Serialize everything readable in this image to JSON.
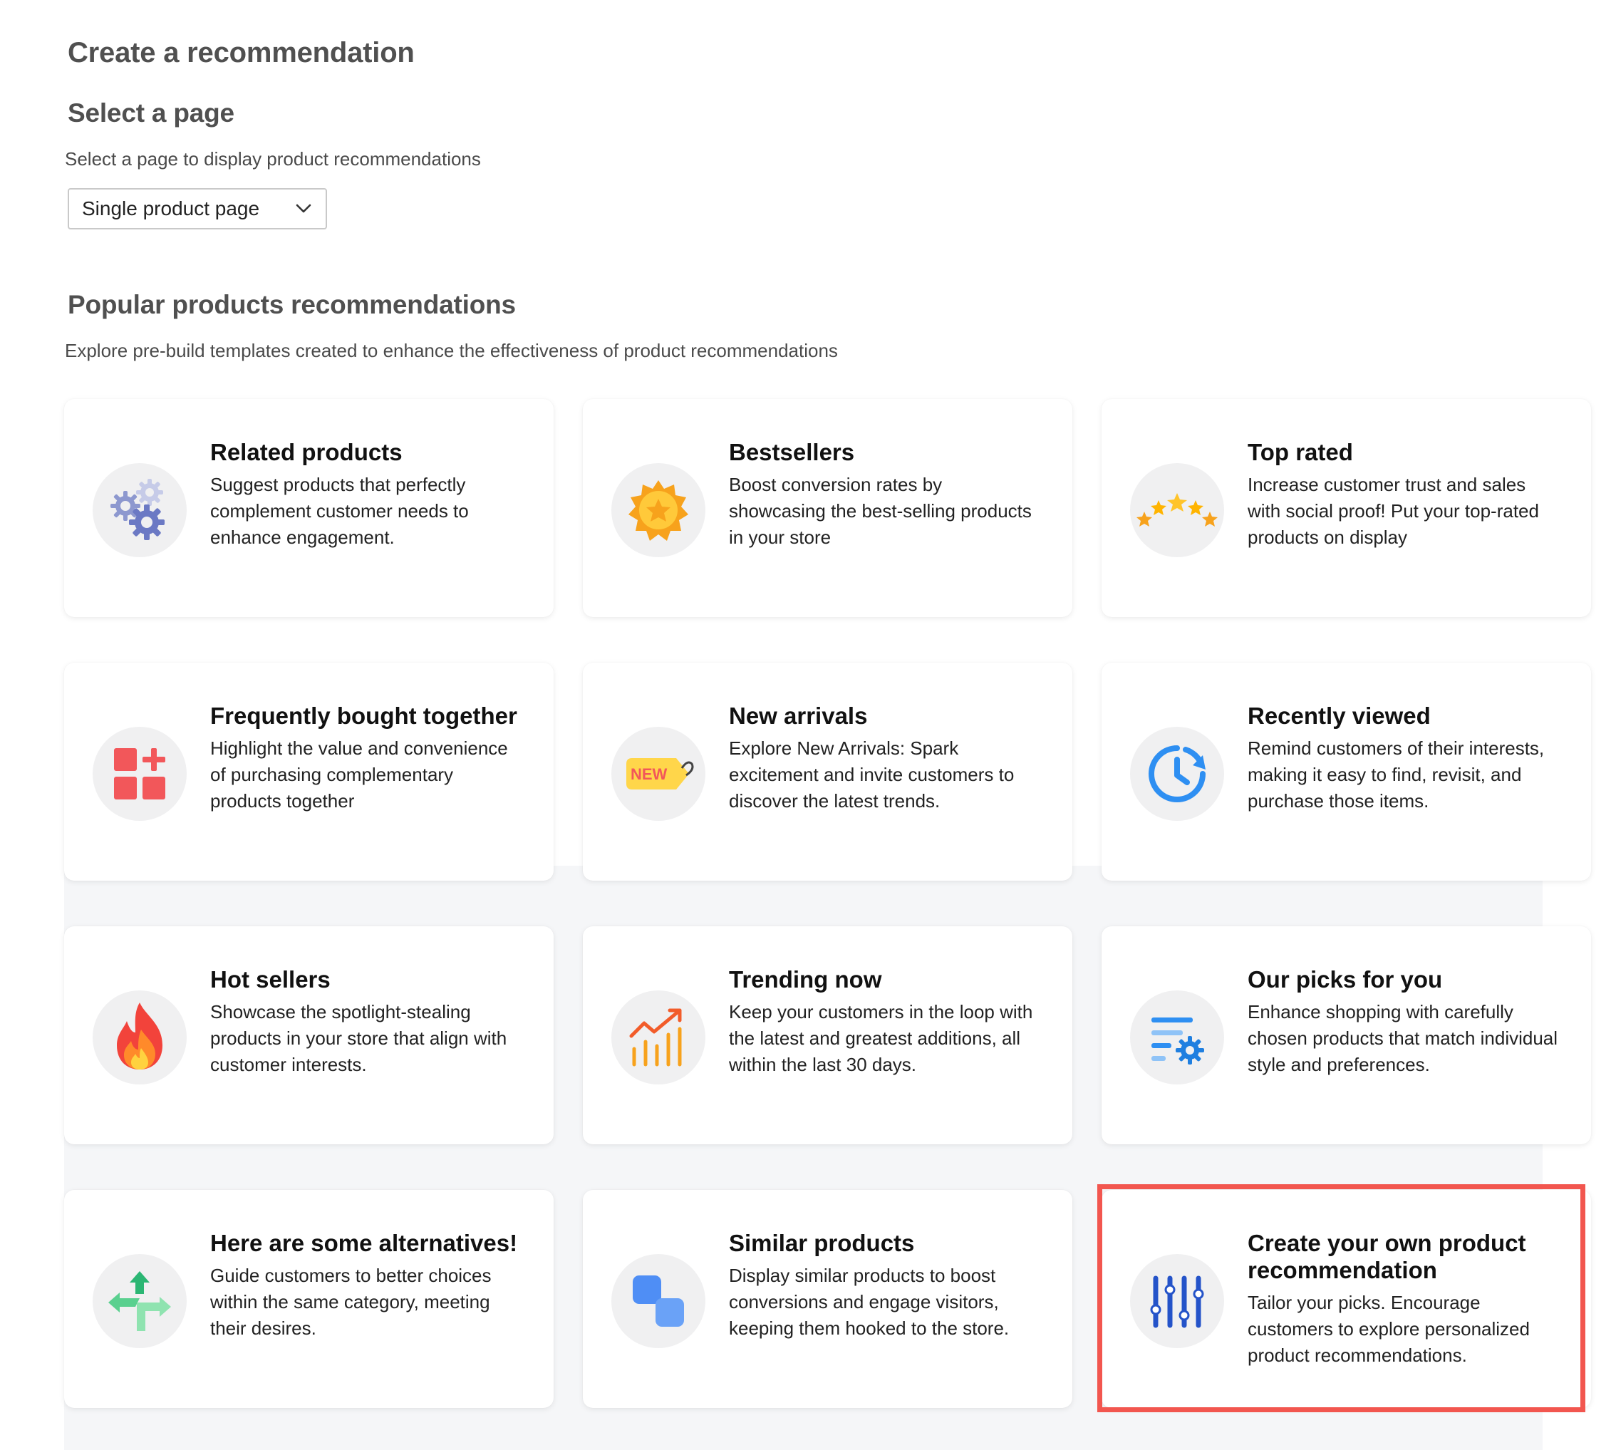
{
  "header": {
    "title": "Create a recommendation"
  },
  "select_page": {
    "title": "Select a page",
    "description": "Select a page to display product recommendations",
    "dropdown_value": "Single product page"
  },
  "popular": {
    "title": "Popular products recommendations",
    "description": "Explore pre-build templates created to enhance the effectiveness of product recommendations"
  },
  "cards": [
    {
      "title": "Related products",
      "description": "Suggest products that perfectly complement customer needs to enhance engagement.",
      "icon": "gears-icon"
    },
    {
      "title": "Bestsellers",
      "description": "Boost conversion rates by showcasing the best-selling products in your store",
      "icon": "star-badge-icon"
    },
    {
      "title": "Top rated",
      "description": "Increase customer trust and sales with social proof! Put your top-rated products on display",
      "icon": "stars-arc-icon"
    },
    {
      "title": "Frequently bought together",
      "description": "Highlight the value and convenience of purchasing complementary products together",
      "icon": "squares-plus-icon"
    },
    {
      "title": "New arrivals",
      "description": "Explore New Arrivals: Spark excitement and invite customers to discover the latest trends.",
      "icon": "new-tag-icon",
      "tag_text": "NEW"
    },
    {
      "title": "Recently viewed",
      "description": "Remind customers of their interests, making it easy to find, revisit, and purchase those items.",
      "icon": "clock-history-icon"
    },
    {
      "title": "Hot sellers",
      "description": "Showcase the spotlight-stealing products in your store that align with customer interests.",
      "icon": "flame-icon"
    },
    {
      "title": "Trending now",
      "description": "Keep your customers in the loop with the latest and greatest additions, all within the last 30 days.",
      "icon": "trending-chart-icon"
    },
    {
      "title": "Our picks for you",
      "description": "Enhance shopping with carefully chosen products that match individual style and preferences.",
      "icon": "list-gear-icon"
    },
    {
      "title": "Here are some alternatives!",
      "description": "Guide customers to better choices within the same category, meeting their desires.",
      "icon": "split-arrows-icon"
    },
    {
      "title": "Similar products",
      "description": "Display similar products to boost conversions and engage visitors, keeping them hooked to the store.",
      "icon": "two-squares-icon"
    },
    {
      "title": "Create your own product recommendation",
      "description": "Tailor your picks. Encourage customers to explore personalized product recommendations.",
      "icon": "sliders-icon"
    }
  ],
  "colors": {
    "heading": "#505050",
    "highlight": "#f2564f",
    "grid_background": "#f5f6f8"
  }
}
